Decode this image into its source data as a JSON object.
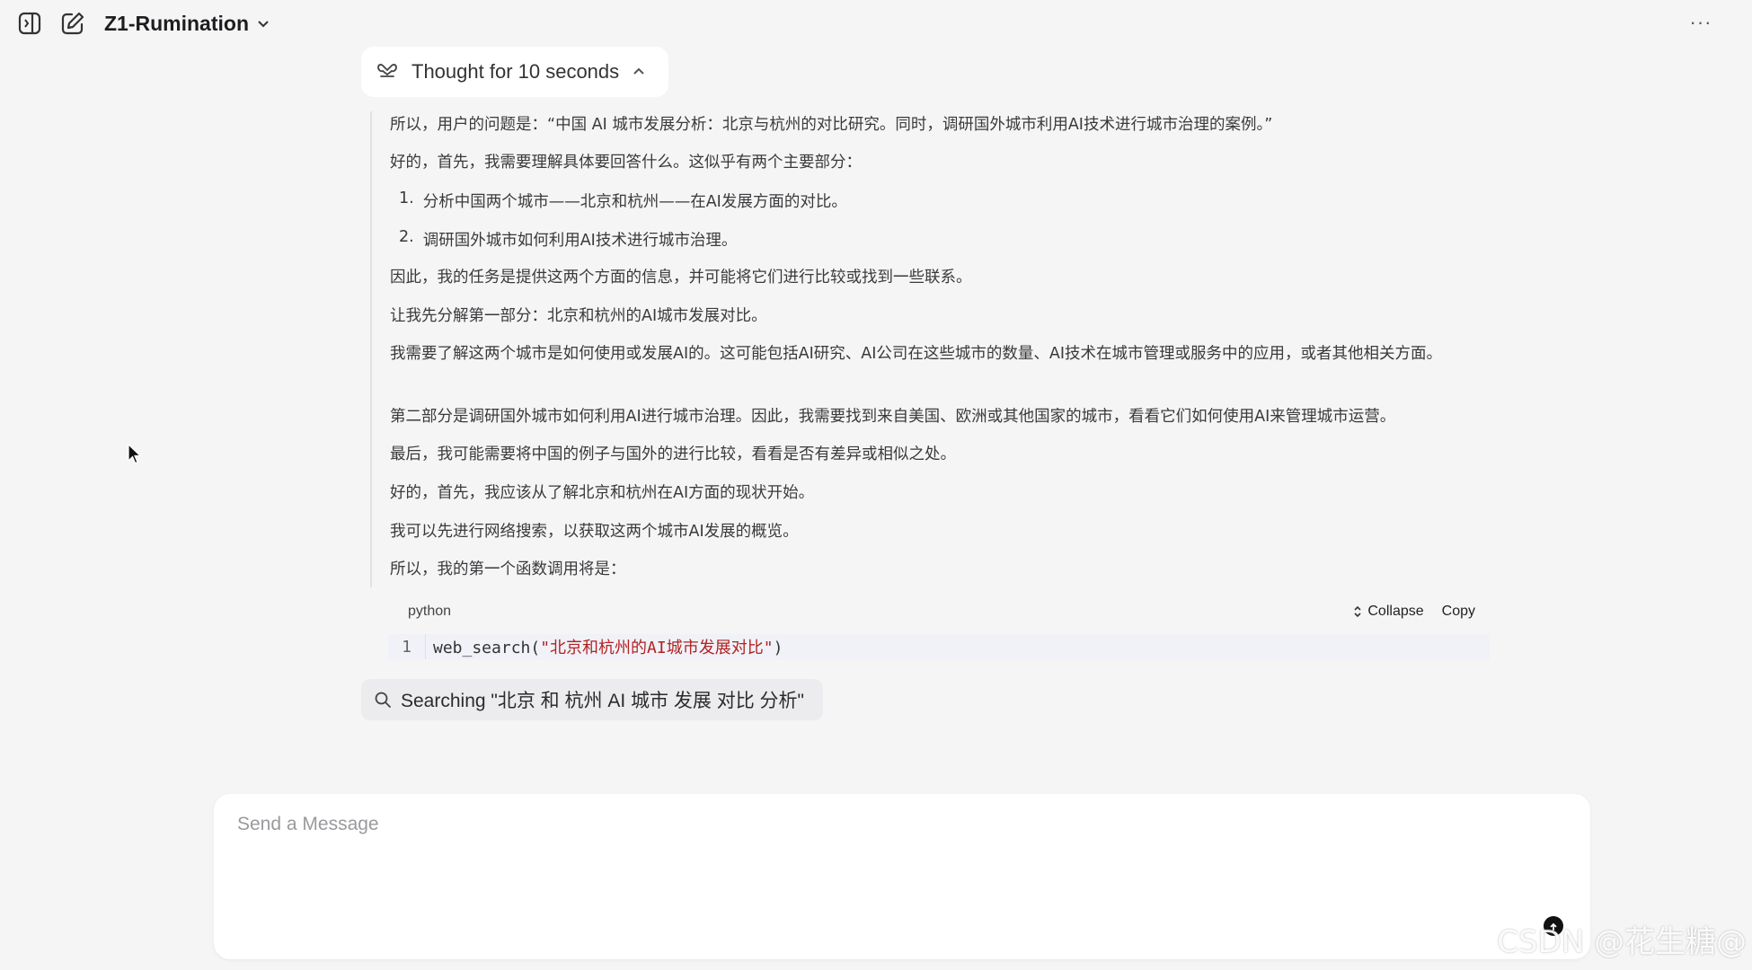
{
  "header": {
    "model_name": "Z1-Rumination",
    "more_label": "···"
  },
  "thought": {
    "toggle_label": "Thought for 10 seconds",
    "paragraphs": [
      "所以，用户的问题是：“中国 AI 城市发展分析：北京与杭州的对比研究。同时，调研国外城市利用AI技术进行城市治理的案例。”",
      "好的，首先，我需要理解具体要回答什么。这似乎有两个主要部分：",
      "因此，我的任务是提供这两个方面的信息，并可能将它们进行比较或找到一些联系。",
      "让我先分解第一部分：北京和杭州的AI城市发展对比。",
      "我需要了解这两个城市是如何使用或发展AI的。这可能包括AI研究、AI公司在这些城市的数量、AI技术在城市管理或服务中的应用，或者其他相关方面。",
      "第二部分是调研国外城市如何利用AI进行城市治理。因此，我需要找到来自美国、欧洲或其他国家的城市，看看它们如何使用AI来管理城市运营。",
      "最后，我可能需要将中国的例子与国外的进行比较，看看是否有差异或相似之处。",
      "好的，首先，我应该从了解北京和杭州在AI方面的现状开始。",
      "我可以先进行网络搜索，以获取这两个城市AI发展的概览。",
      "所以，我的第一个函数调用将是："
    ],
    "list_items": [
      {
        "num": "1.",
        "text": "分析中国两个城市——北京和杭州——在AI发展方面的对比。"
      },
      {
        "num": "2.",
        "text": "调研国外城市如何利用AI技术进行城市治理。"
      }
    ]
  },
  "code": {
    "language": "python",
    "collapse_label": "Collapse",
    "copy_label": "Copy",
    "line_number": "1",
    "code_prefix": "web_search(",
    "code_string": "\"北京和杭州的AI城市发展对比\"",
    "code_suffix": ")"
  },
  "search": {
    "status_text": "Searching \"北京 和 杭州 AI 城市 发展 对比 分析\""
  },
  "composer": {
    "placeholder": "Send a Message"
  },
  "watermark": "CSDN @花生糖@"
}
